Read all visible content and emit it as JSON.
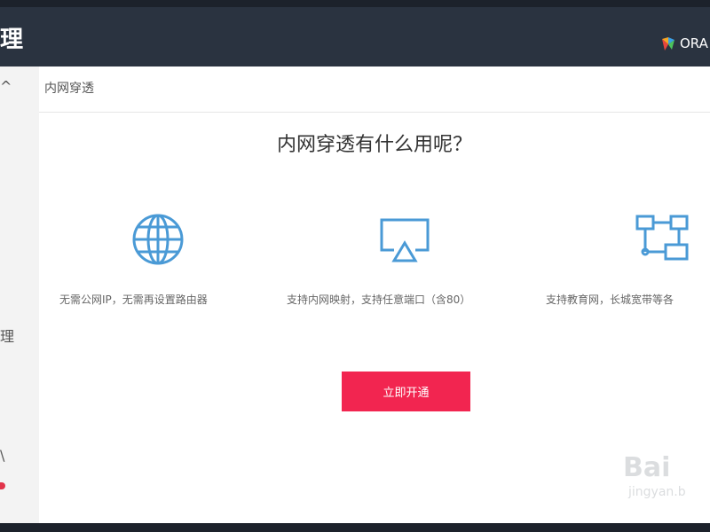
{
  "header": {
    "brand_fragment": "理",
    "router_name": "ORA"
  },
  "sidebar": {
    "glyphs": [
      "^",
      "理",
      "\\"
    ]
  },
  "breadcrumb": "内网穿透",
  "headline": "内网穿透有什么用呢？",
  "features": [
    {
      "icon": "globe-icon",
      "text": "无需公网IP，无需再设置路由器"
    },
    {
      "icon": "screen-cast-icon",
      "text": "支持内网映射，支持任意端口（含80）"
    },
    {
      "icon": "network-topology-icon",
      "text": "支持教育网，长城宽带等各"
    }
  ],
  "cta_label": "立即开通",
  "watermark": {
    "logo": "Bai",
    "domain": "jingyan.b"
  },
  "colors": {
    "topbar": "#2a3340",
    "icon_blue": "#4a9ad6",
    "cta_red": "#f22550"
  }
}
